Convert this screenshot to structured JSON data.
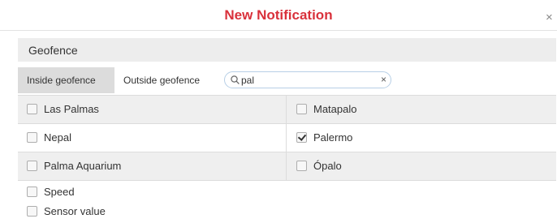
{
  "dialog": {
    "title": "New Notification",
    "close_glyph": "×"
  },
  "section": {
    "title": "Geofence"
  },
  "tabs": [
    {
      "label": "Inside geofence",
      "active": true
    },
    {
      "label": "Outside geofence",
      "active": false
    }
  ],
  "search": {
    "value": "pal",
    "clear_glyph": "×"
  },
  "geofences": [
    {
      "label": "Las Palmas",
      "checked": false
    },
    {
      "label": "Matapalo",
      "checked": false
    },
    {
      "label": "Nepal",
      "checked": false
    },
    {
      "label": "Palermo",
      "checked": true
    },
    {
      "label": "Palma Aquarium",
      "checked": false
    },
    {
      "label": "Ópalo",
      "checked": false
    }
  ],
  "options": [
    {
      "label": "Speed",
      "checked": false
    },
    {
      "label": "Sensor value",
      "checked": false
    }
  ],
  "colors": {
    "title": "#d9313b",
    "active_tab": "#dcdcdc",
    "search_border": "#b7cfe6"
  }
}
